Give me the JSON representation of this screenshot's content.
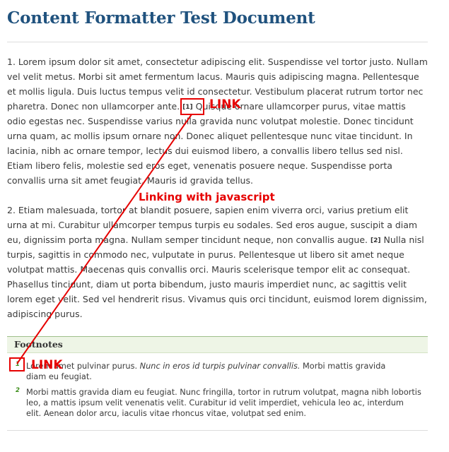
{
  "page": {
    "title": "Content Formatter Test Document"
  },
  "paragraph1": {
    "lines": [
      "1. Lorem ipsum dolor sit amet, consectetur adipiscing elit. Suspendisse vel tortor justo. Nullam",
      "vel velit metus. Morbi sit amet fermentum lacus. Mauris quis adipiscing magna. Pellentesque",
      "et mollis ligula. Duis luctus tempus velit id consectetur. Vestibulum placerat rutrum tortor nec"
    ],
    "line4_before": "pharetra. Donec non ullamcorper ante.",
    "ref1": "[1]",
    "line4_after": "Quisque ornare ullamcorper purus, vitae mattis",
    "lines_rest": [
      "odio egestas nec. Suspendisse varius nulla gravida nunc volutpat molestie. Donec tincidunt",
      "urna quam, ac mollis ipsum ornare non. Donec aliquet pellentesque nunc vitae tincidunt. In",
      "lacinia, nibh ac ornare tempor, lectus dui euismod libero, a convallis libero tellus sed nisl.",
      "Etiam libero felis, molestie sed eros eget, venenatis posuere neque. Suspendisse porta",
      "convallis urna sit amet feugiat. Mauris id gravida tellus."
    ]
  },
  "paragraph2": {
    "lines_start": [
      "2. Etiam malesuada, tortor at blandit posuere, sapien enim viverra orci, varius pretium elit",
      "urna at mi. Curabitur ullamcorper tempus turpis eu sodales. Sed eros augue, suscipit a diam"
    ],
    "line3_before": "eu, dignissim porta magna. Nullam semper tincidunt neque, non convallis augue.",
    "ref2": "[2]",
    "line3_after": "Nulla nisl",
    "lines_rest": [
      "turpis, sagittis in commodo nec, vulputate in purus. Pellentesque ut libero sit amet neque",
      "volutpat mattis. Maecenas quis convallis orci. Mauris scelerisque tempor elit ac consequat.",
      "Phasellus tincidunt, diam ut porta bibendum, justo mauris imperdiet nunc, ac sagittis velit",
      "lorem eget velit. Sed vel hendrerit risus. Vivamus quis orci tincidunt, euismod lorem dignissim,",
      "adipiscing purus."
    ]
  },
  "footnotes": {
    "header": "Footnotes",
    "items": [
      {
        "num": "1",
        "line1_before": "Lorem amet pulvinar purus.",
        "line1_italic": "Nunc in eros id turpis pulvinar convallis.",
        "line1_after": "Morbi mattis gravida",
        "line2": "diam eu feugiat."
      },
      {
        "num": "2",
        "lines": [
          "Morbi mattis gravida diam eu feugiat. Nunc fringilla, tortor in rutrum volutpat, magna nibh lobortis",
          "leo, a mattis ipsum velit venenatis velit. Curabitur id velit imperdiet, vehicula leo ac, interdum",
          "elit. Aenean dolor arcu, iaculis vitae rhoncus vitae, volutpat sed enim."
        ]
      }
    ]
  },
  "annotations": {
    "link_label_top": "LINK",
    "link_label_bottom": "LINK",
    "js_label": "Linking with javascript",
    "color": "#e60000"
  }
}
